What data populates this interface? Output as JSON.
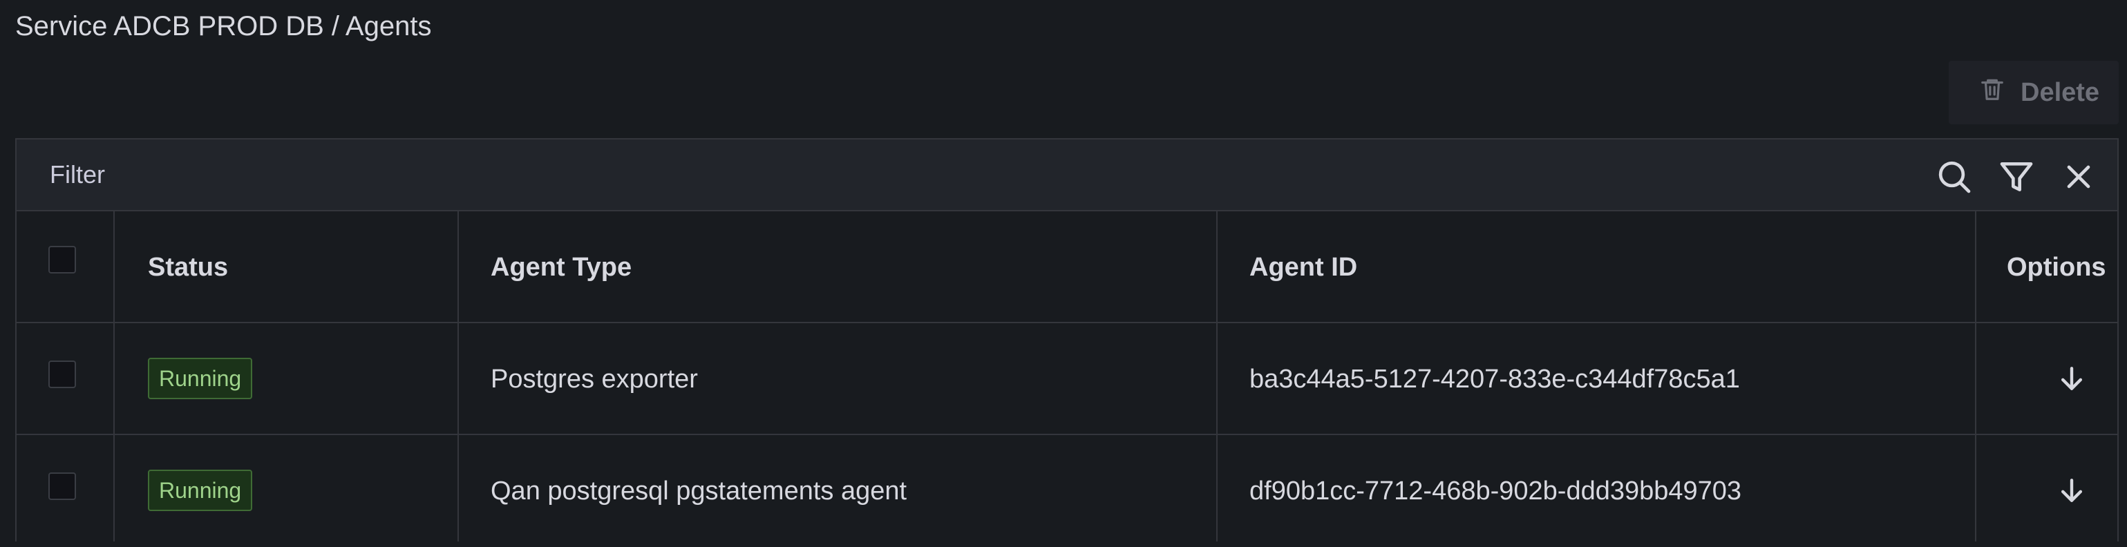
{
  "breadcrumb": "Service ADCB PROD DB / Agents",
  "toolbar": {
    "delete_label": "Delete"
  },
  "filter": {
    "label": "Filter",
    "icons": [
      "search-icon",
      "filter-funnel-icon",
      "close-icon"
    ]
  },
  "table": {
    "columns": [
      "Status",
      "Agent Type",
      "Agent ID",
      "Options"
    ],
    "rows": [
      {
        "status": "Running",
        "agent_type": "Postgres exporter",
        "agent_id": "ba3c44a5-5127-4207-833e-c344df78c5a1",
        "options_icon": "arrow-down-icon"
      },
      {
        "status": "Running",
        "agent_type": "Qan postgresql pgstatements agent",
        "agent_id": "df90b1cc-7712-468b-902b-ddd39bb49703",
        "options_icon": "arrow-down-icon"
      }
    ]
  },
  "colors": {
    "background": "#181b1f",
    "filter_bar": "#22252b",
    "border": "#34363c",
    "running_badge_bg": "#1b3319",
    "running_badge_text": "#9fd38b",
    "disabled_text": "#6e7079"
  }
}
